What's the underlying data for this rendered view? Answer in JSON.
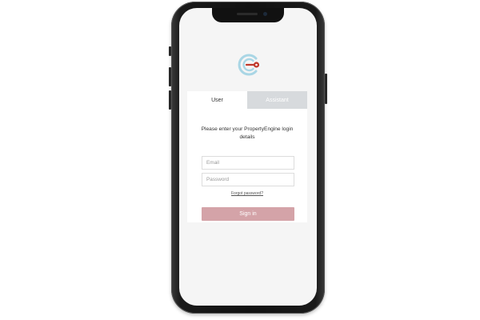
{
  "app": {
    "name": "PropertyEngine",
    "logo_icon": "propertyengine-logo-icon",
    "accent_color": "#d4a3a8",
    "logo_colors": [
      "#a9d6e5",
      "#c0392b"
    ]
  },
  "tabs": [
    {
      "label": "User",
      "active": true
    },
    {
      "label": "Assistant",
      "active": false
    }
  ],
  "login": {
    "prompt": "Please enter your PropertyEngine login details",
    "email_placeholder": "Email",
    "password_placeholder": "Password",
    "forgot_label": "Forgot password?",
    "signin_label": "Sign in"
  }
}
